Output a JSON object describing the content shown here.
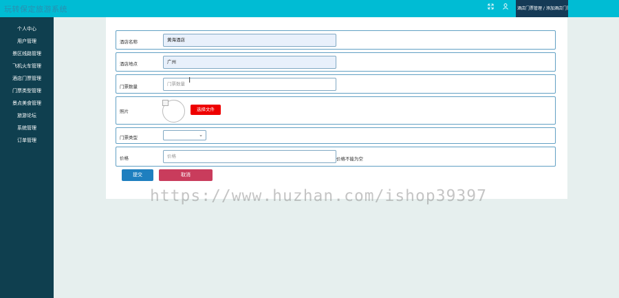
{
  "header": {
    "app_title": "玩转保定旅游系统",
    "breadcrumb": "酒店门票管理 / 添加酒店门票",
    "fullscreen_icon": "expand-icon",
    "user_icon": "user-icon"
  },
  "sidebar": {
    "items": [
      {
        "label": "个人中心"
      },
      {
        "label": "用户管理"
      },
      {
        "label": "景区线路管理"
      },
      {
        "label": "飞机火车管理"
      },
      {
        "label": "酒店门票管理"
      },
      {
        "label": "门票类型管理"
      },
      {
        "label": "景点美食管理"
      },
      {
        "label": "旅游论坛"
      },
      {
        "label": "系统管理"
      },
      {
        "label": "订单管理"
      }
    ]
  },
  "form": {
    "hotel_name": {
      "label": "酒店名称",
      "value": "黄海酒店"
    },
    "hotel_location": {
      "label": "酒店地点",
      "value": "广州"
    },
    "ticket_count": {
      "label": "门票数量",
      "placeholder": "门票数量"
    },
    "photo": {
      "label": "照片",
      "button": "选择文件"
    },
    "ticket_type": {
      "label": "门票类型",
      "value": ""
    },
    "price": {
      "label": "价格",
      "placeholder": "价格",
      "error": "价格不能为空"
    },
    "submit_label": "提交",
    "cancel_label": "取消"
  },
  "watermark": "https://www.huzhan.com/ishop39397",
  "colors": {
    "topbar": "#00bcd4",
    "sidebar": "#0f3f4f",
    "submit": "#1e7fbf",
    "cancel": "#c93c5c",
    "file_button": "#ee0000"
  }
}
